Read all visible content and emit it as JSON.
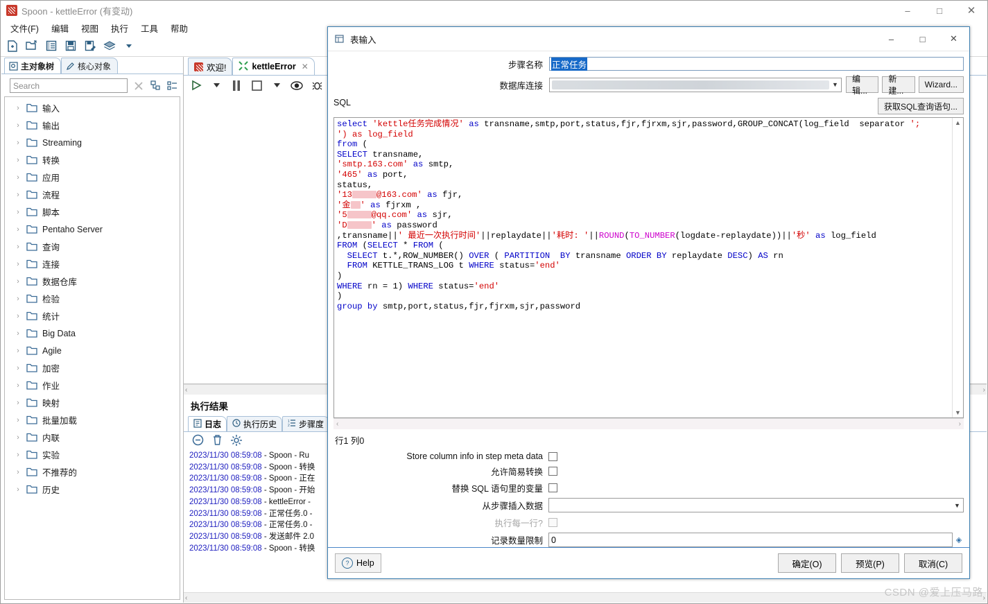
{
  "window": {
    "title": "Spoon - kettleError (有变动)",
    "app_icon": "spoon-icon",
    "minimize": "–",
    "maximize": "□",
    "close": "✕"
  },
  "menubar": [
    "文件(F)",
    "编辑",
    "视图",
    "执行",
    "工具",
    "帮助"
  ],
  "toolbar_icons": [
    "new-file-icon",
    "open-folder-icon",
    "explorer-icon",
    "save-icon",
    "save-as-icon",
    "layers-icon",
    "dropdown-caret-icon"
  ],
  "sidebar": {
    "tabs": [
      {
        "label": "主对象树",
        "icon": "tree-view-icon",
        "active": true
      },
      {
        "label": "核心对象",
        "icon": "pencil-icon",
        "active": false
      }
    ],
    "search": {
      "placeholder": "Search",
      "value": "",
      "clear_icon": "clear-x-icon"
    },
    "view_icons": [
      "collapse-all-icon",
      "expand-all-icon"
    ],
    "items": [
      {
        "label": "输入"
      },
      {
        "label": "输出"
      },
      {
        "label": "Streaming"
      },
      {
        "label": "转换"
      },
      {
        "label": "应用"
      },
      {
        "label": "流程"
      },
      {
        "label": "脚本"
      },
      {
        "label": "Pentaho Server"
      },
      {
        "label": "查询"
      },
      {
        "label": "连接"
      },
      {
        "label": "数据仓库"
      },
      {
        "label": "检验"
      },
      {
        "label": "统计"
      },
      {
        "label": "Big Data"
      },
      {
        "label": "Agile"
      },
      {
        "label": "加密"
      },
      {
        "label": "作业"
      },
      {
        "label": "映射"
      },
      {
        "label": "批量加载"
      },
      {
        "label": "内联"
      },
      {
        "label": "实验"
      },
      {
        "label": "不推荐的"
      },
      {
        "label": "历史"
      }
    ]
  },
  "canvas": {
    "tabs": [
      {
        "label": "欢迎!",
        "icon": "spoon-icon",
        "active": false,
        "closable": false
      },
      {
        "label": "kettleError",
        "icon": "transformation-icon",
        "active": true,
        "closable": true,
        "close": "✕"
      }
    ],
    "toolbar_icons": [
      "run-icon",
      "run-dropdown-icon",
      "pause-icon",
      "stop-icon",
      "stop-dropdown-icon",
      "preview-icon",
      "debug-icon",
      "replay-icon",
      "transformation-icon"
    ]
  },
  "results": {
    "title": "执行结果",
    "tabs": [
      {
        "label": "日志",
        "icon": "log-icon",
        "active": true
      },
      {
        "label": "执行历史",
        "icon": "clock-icon",
        "active": false
      },
      {
        "label": "步骤度",
        "icon": "metrics-icon",
        "active": false
      }
    ],
    "tool_icons": [
      "clear-log-icon",
      "delete-icon",
      "settings-gear-icon"
    ],
    "log_lines": [
      {
        "ts": "2023/11/30 08:59:08",
        "rest": " - Spoon - Ru"
      },
      {
        "ts": "2023/11/30 08:59:08",
        "rest": " - Spoon - 转换"
      },
      {
        "ts": "2023/11/30 08:59:08",
        "rest": " - Spoon - 正在"
      },
      {
        "ts": "2023/11/30 08:59:08",
        "rest": " - Spoon - 开始"
      },
      {
        "ts": "2023/11/30 08:59:08",
        "rest": " - kettleError -"
      },
      {
        "ts": "2023/11/30 08:59:08",
        "rest": " - 正常任务.0 - "
      },
      {
        "ts": "2023/11/30 08:59:08",
        "rest": " - 正常任务.0 - "
      },
      {
        "ts": "2023/11/30 08:59:08",
        "rest": " - 发送邮件 2.0"
      },
      {
        "ts": "2023/11/30 08:59:08",
        "rest": " - Spoon - 转换"
      }
    ]
  },
  "dialog": {
    "title": "表输入",
    "icon": "table-input-icon",
    "minimize": "–",
    "maximize": "□",
    "close": "✕",
    "step_name": {
      "label": "步骤名称",
      "value": "正常任务",
      "selected": true
    },
    "connection": {
      "label": "数据库连接",
      "value": "",
      "redacted": true,
      "buttons": [
        "编辑...",
        "新建...",
        "Wizard..."
      ]
    },
    "sql_label": "SQL",
    "get_sql_button": "获取SQL查询语句...",
    "status": "行1 列0",
    "checkboxes": [
      {
        "label": "Store column info in step meta data",
        "checked": false,
        "disabled": false
      },
      {
        "label": "允许简易转换",
        "checked": false,
        "disabled": false
      },
      {
        "label": "替换 SQL 语句里的变量",
        "checked": false,
        "disabled": false
      }
    ],
    "insert_from_step": {
      "label": "从步骤插入数据",
      "value": ""
    },
    "execute_each_row": {
      "label": "执行每一行?",
      "checked": false,
      "disabled": true
    },
    "row_limit": {
      "label": "记录数量限制",
      "value": "0"
    },
    "help_button": "Help",
    "footer_buttons": [
      "确定(O)",
      "预览(P)",
      "取消(C)"
    ],
    "sql_lines": [
      "select 'kettle任务完成情况' as transname,smtp,port,status,fjr,fjrxm,sjr,password,GROUP_CONCAT(log_field  separator ';",
      "') as log_field",
      "from (",
      "SELECT transname,",
      "'smtp.163.com' as smtp,",
      "'465' as port,",
      "status,",
      "'13*****@163.com' as fjr,",
      "'金**' as fjrxm ,",
      "'5*****@qq.com' as sjr,",
      "'D*****' as password",
      ",transname||' 最近一次执行时间'||replaydate||'耗时: '||ROUND(TO_NUMBER(logdate-replaydate))||'秒' as log_field",
      "FROM (SELECT * FROM (",
      "  SELECT t.*,ROW_NUMBER() OVER ( PARTITION  BY transname ORDER BY replaydate DESC) AS rn",
      "  FROM KETTLE_TRANS_LOG t WHERE status='end'",
      ")",
      "WHERE rn = 1) WHERE status='end'",
      ")",
      "group by smtp,port,status,fjr,fjrxm,sjr,password"
    ]
  },
  "watermark": "CSDN @爱上压马路"
}
